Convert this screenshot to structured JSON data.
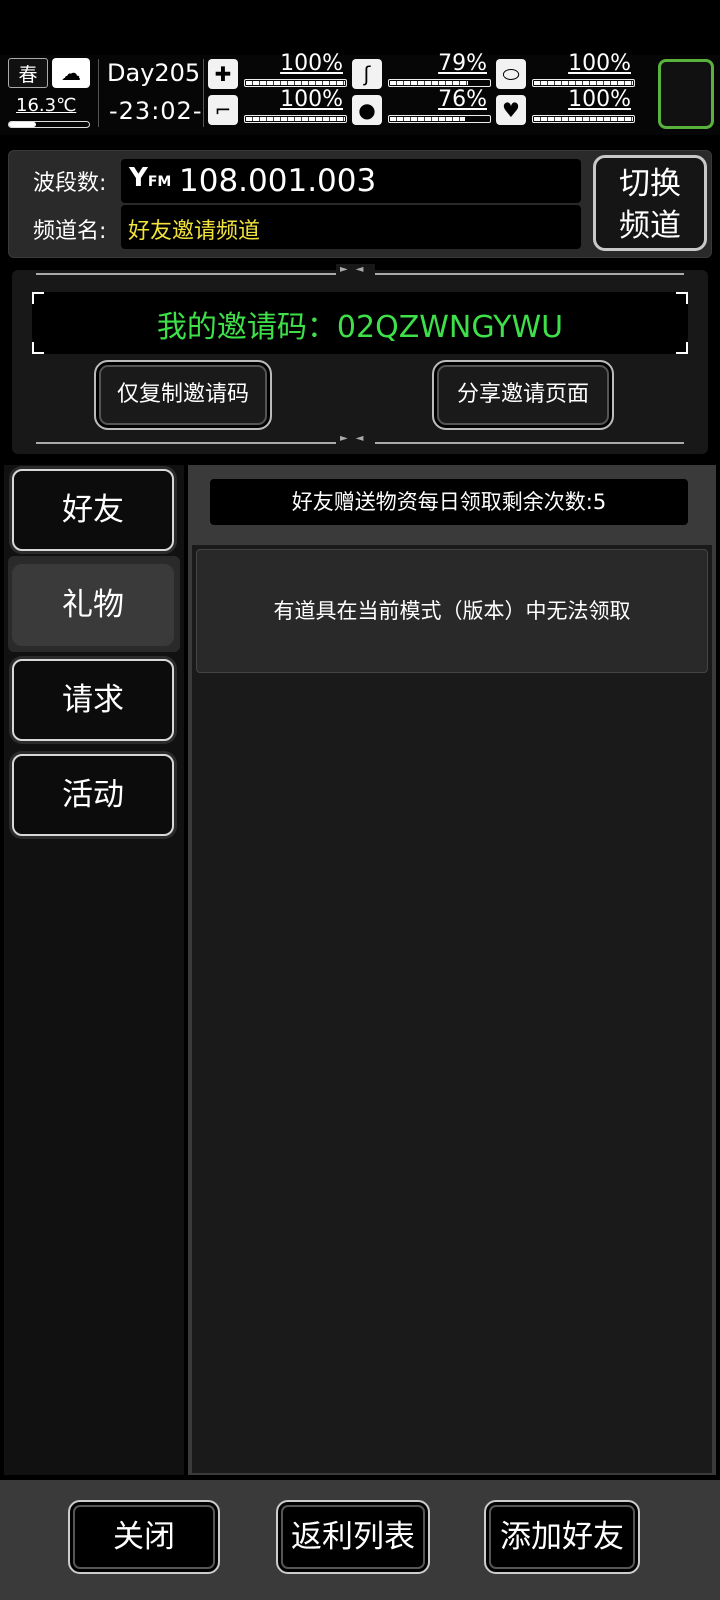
{
  "hud": {
    "season": "春",
    "temperature": "16.3℃",
    "temperature_level": 0.34,
    "day": "Day205",
    "time": "-23:02-",
    "stats": [
      {
        "icon": "medkit-icon",
        "glyph": "✚",
        "value": "100%",
        "level": 1.0
      },
      {
        "icon": "stomach-icon",
        "glyph": "ʃ",
        "value": "79%",
        "level": 0.79
      },
      {
        "icon": "pill-icon",
        "glyph": "⬭",
        "value": "100%",
        "level": 1.0
      },
      {
        "icon": "boot-icon",
        "glyph": "⌐",
        "value": "100%",
        "level": 1.0
      },
      {
        "icon": "water-drop-icon",
        "glyph": "●",
        "value": "76%",
        "level": 0.76
      },
      {
        "icon": "heart-icon",
        "glyph": "♥",
        "value": "100%",
        "level": 1.0
      }
    ],
    "accent": "#58b23c"
  },
  "radio": {
    "freq_label": "波段数:",
    "freq_icon": "Y",
    "freq_icon_sub": "FM",
    "frequency": "108.001.003",
    "name_label": "频道名:",
    "channel_name": "好友邀请频道",
    "switch_line1": "切换",
    "switch_line2": "频道"
  },
  "invite": {
    "code_text": "我的邀请码：02QZWNGYWU",
    "copy_button": "仅复制邀请码",
    "share_button": "分享邀请页面"
  },
  "tabs": [
    {
      "label": "好友",
      "active": false
    },
    {
      "label": "礼物",
      "active": true
    },
    {
      "label": "请求",
      "active": false
    },
    {
      "label": "活动",
      "active": false
    }
  ],
  "content": {
    "daily_count": "好友赠送物资每日领取剩余次数:5",
    "notice": "有道具在当前模式（版本）中无法领取"
  },
  "bottom": {
    "close": "关闭",
    "rebate": "返利列表",
    "add_friend": "添加好友"
  }
}
